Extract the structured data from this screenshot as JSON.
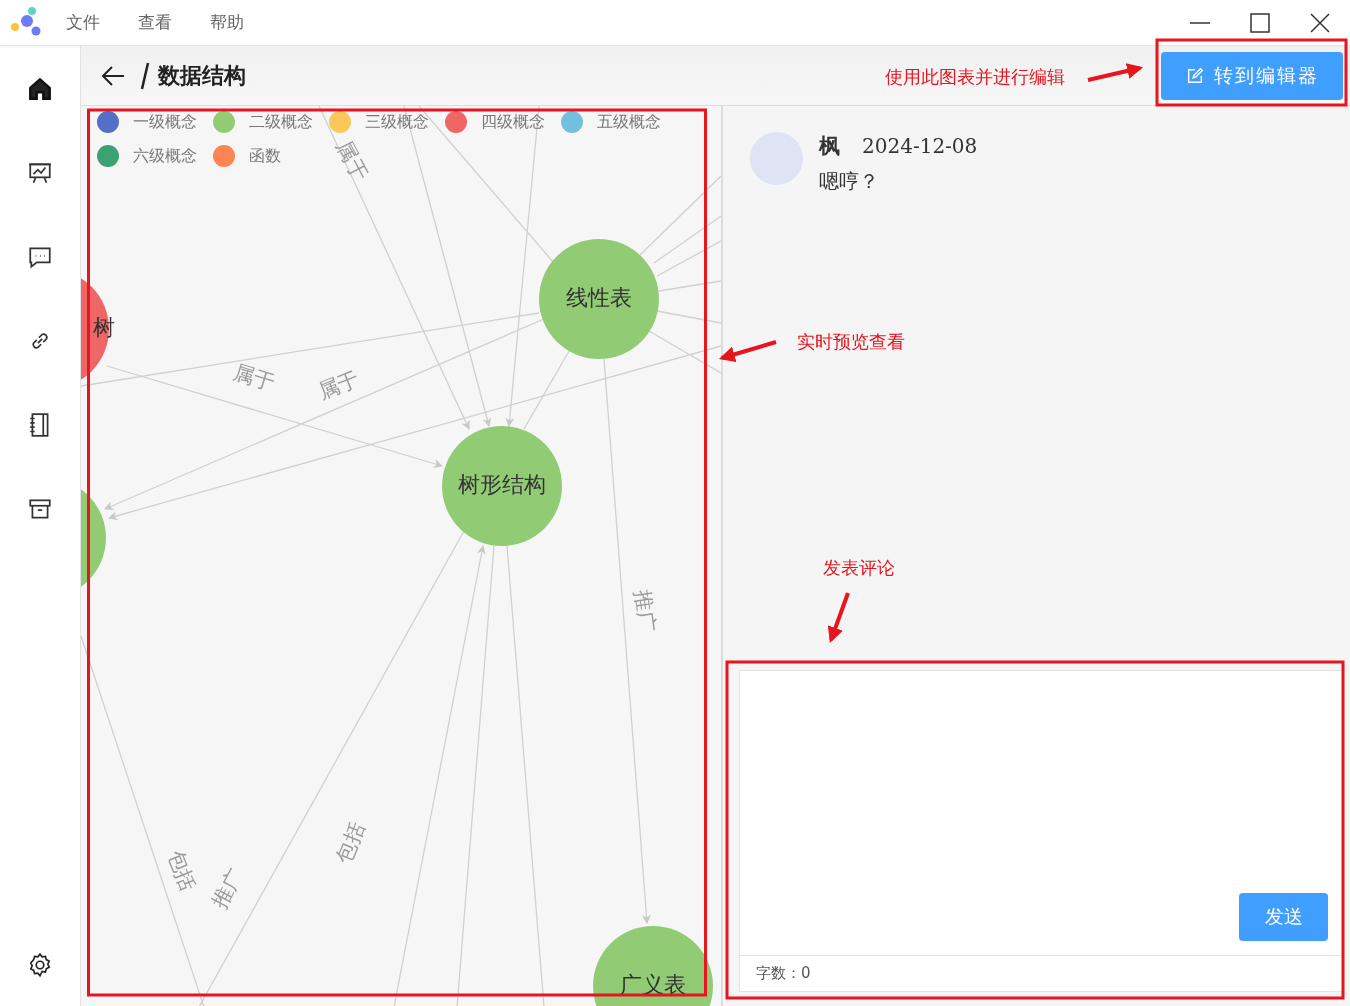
{
  "menu": [
    {
      "label": "文件"
    },
    {
      "label": "查看"
    },
    {
      "label": "帮助"
    }
  ],
  "sidebar": {
    "items": [
      {
        "kind": "home",
        "selected": true
      },
      {
        "kind": "board",
        "selected": false
      },
      {
        "kind": "chat",
        "selected": false
      },
      {
        "kind": "link",
        "selected": false
      },
      {
        "kind": "notebook",
        "selected": false
      },
      {
        "kind": "archive",
        "selected": false
      }
    ]
  },
  "header": {
    "title": "数据结构",
    "button": "转到编辑器"
  },
  "graph": {
    "legend": [
      {
        "label": "一级概念",
        "color": "#5470c6"
      },
      {
        "label": "二级概念",
        "color": "#91cc75"
      },
      {
        "label": "三级概念",
        "color": "#fac858"
      },
      {
        "label": "四级概念",
        "color": "#ee6666"
      },
      {
        "label": "五级概念",
        "color": "#73c0de"
      },
      {
        "label": "六级概念",
        "color": "#3ba272"
      },
      {
        "label": "函数",
        "color": "#fc8452"
      }
    ],
    "nodes": [
      {
        "label": "树",
        "color": "#ee6666"
      },
      {
        "label": "线性表",
        "color": "#91cc75"
      },
      {
        "label": "树形结构",
        "color": "#91cc75"
      },
      {
        "color": "#91cc75"
      },
      {
        "label": "广义表",
        "color": "#91cc75"
      }
    ],
    "edge_labels": [
      "属于",
      "属于",
      "属于",
      "推广",
      "包括",
      "推广",
      "包括"
    ]
  },
  "comments": [
    {
      "author": "枫",
      "date": "2024-12-08",
      "text": "嗯哼？"
    }
  ],
  "composer": {
    "send": "发送",
    "count": "字数：0"
  },
  "annotations": [
    {
      "text": "使用此图表并进行编辑"
    },
    {
      "text": "实时预览查看"
    },
    {
      "text": "发表评论"
    }
  ]
}
